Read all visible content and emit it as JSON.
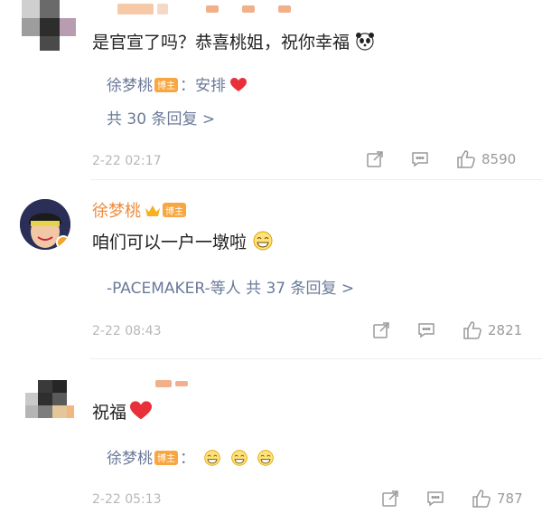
{
  "comments": [
    {
      "text": "是官宣了吗？恭喜桃姐，祝你幸福",
      "reply": {
        "name": "徐梦桃",
        "badge": "博主",
        "sep": "：",
        "text": "安排"
      },
      "more": "共 30 条回复 >",
      "time": "2-22 02:17",
      "likes": "8590"
    },
    {
      "author": "徐梦桃",
      "badge": "博主",
      "text": "咱们可以一户一墩啦",
      "reply_summary": "-PACEMAKER-等人 共 37 条回复 >",
      "time": "2-22 08:43",
      "likes": "2821"
    },
    {
      "text": "祝福",
      "reply": {
        "name": "徐梦桃",
        "badge": "博主",
        "sep": "：",
        "text": ""
      },
      "time": "2-22 05:13",
      "likes": "787"
    }
  ],
  "icons": {
    "share": "share-icon",
    "comment": "comment-icon",
    "like": "like-icon",
    "heart": "heart-emoji",
    "panda": "panda-emoji",
    "grin": "grin-emoji",
    "crown": "crown-icon"
  },
  "colors": {
    "link": "#6b7a99",
    "badge": "#f7a640",
    "heart": "#e8303a",
    "muted": "#b7b7b7"
  }
}
